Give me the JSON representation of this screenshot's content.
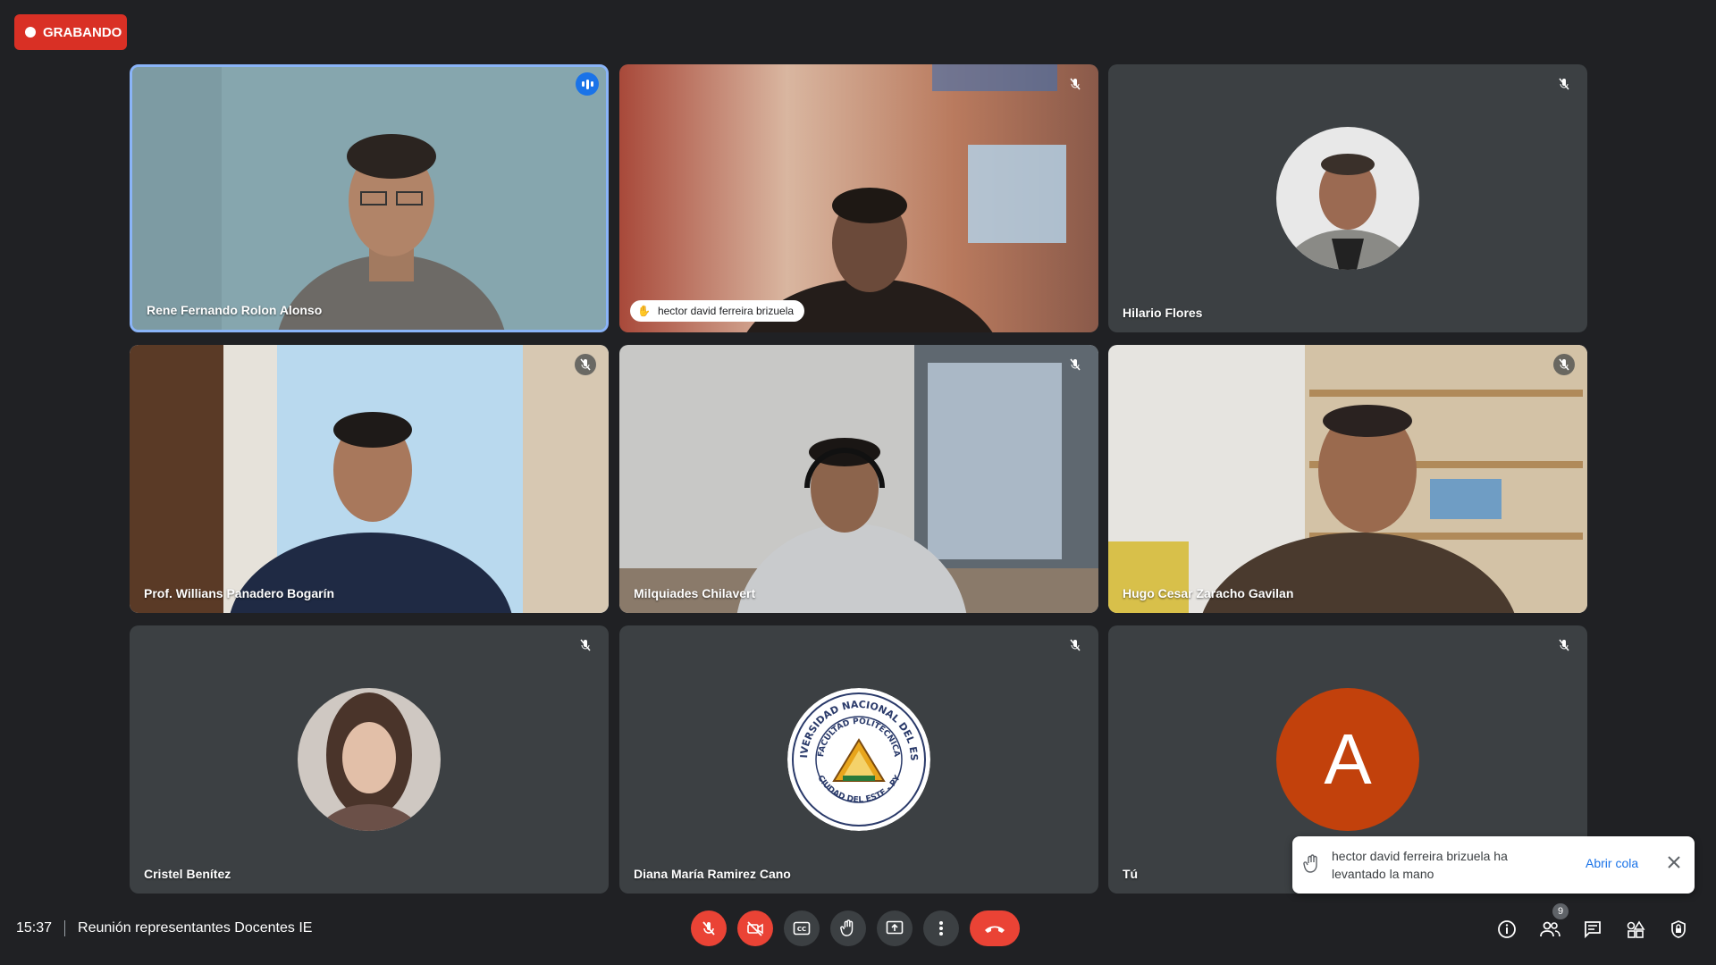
{
  "recording": {
    "label": "GRABANDO"
  },
  "tiles": [
    {
      "name": "Rene Fernando Rolon Alonso"
    },
    {
      "name": "hector david ferreira brizuela"
    },
    {
      "name": "Hilario Flores"
    },
    {
      "name": "Prof. Willians Panadero Bogarín"
    },
    {
      "name": "Milquiades Chilavert"
    },
    {
      "name": "Hugo Cesar Zaracho Gavilan"
    },
    {
      "name": "Cristel Benítez"
    },
    {
      "name": "Diana María Ramirez Cano"
    },
    {
      "name": "Tú",
      "avatar_letter": "A"
    }
  ],
  "logo": {
    "text_top": "UNIVERSIDAD NACIONAL DEL ESTE",
    "text_inner": "FACULTAD POLITÉCNICA",
    "text_bottom": "CIUDAD DEL ESTE - PY"
  },
  "toast": {
    "message": "hector david ferreira brizuela ha levantado la mano",
    "action": "Abrir cola"
  },
  "footer": {
    "time": "15:37",
    "meeting_title": "Reunión representantes Docentes IE",
    "participants_count": "9"
  },
  "colors": {
    "recording": "#d93025",
    "end_call": "#ea4335",
    "avatar_you": "#c2410c",
    "active_border": "#8ab4f8"
  }
}
